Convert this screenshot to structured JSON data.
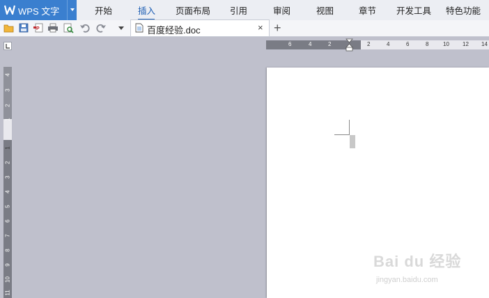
{
  "app": {
    "title": "WPS 文字"
  },
  "menu": {
    "tabs": [
      {
        "label": "开始"
      },
      {
        "label": "插入"
      },
      {
        "label": "页面布局"
      },
      {
        "label": "引用"
      },
      {
        "label": "审阅"
      },
      {
        "label": "视图"
      },
      {
        "label": "章节"
      },
      {
        "label": "开发工具"
      },
      {
        "label": "特色功能"
      }
    ],
    "active_tab": "插入"
  },
  "document_tab": {
    "label": "百度经验.doc",
    "close": "×",
    "new_tab": "+"
  },
  "toolbar_icons": [
    "open-folder-icon",
    "save-icon",
    "pdf-export-icon",
    "print-icon",
    "print-preview-icon",
    "undo-icon",
    "redo-icon",
    "dropdown-icon"
  ],
  "hruler": {
    "labels": [
      "6",
      "4",
      "2",
      "2",
      "4",
      "6",
      "8",
      "10",
      "12",
      "14"
    ]
  },
  "vruler": {
    "labels": [
      "4",
      "3",
      "2",
      "1",
      "1",
      "2",
      "3",
      "4",
      "5",
      "6",
      "7",
      "8",
      "9",
      "10",
      "11"
    ]
  },
  "watermark": {
    "main": "Bai du 经验",
    "sub": "jingyan.baidu.com"
  },
  "colors": {
    "accent": "#3a7fcf",
    "active_tab": "#1e5fb4",
    "workspace": "#bfc0cc"
  }
}
